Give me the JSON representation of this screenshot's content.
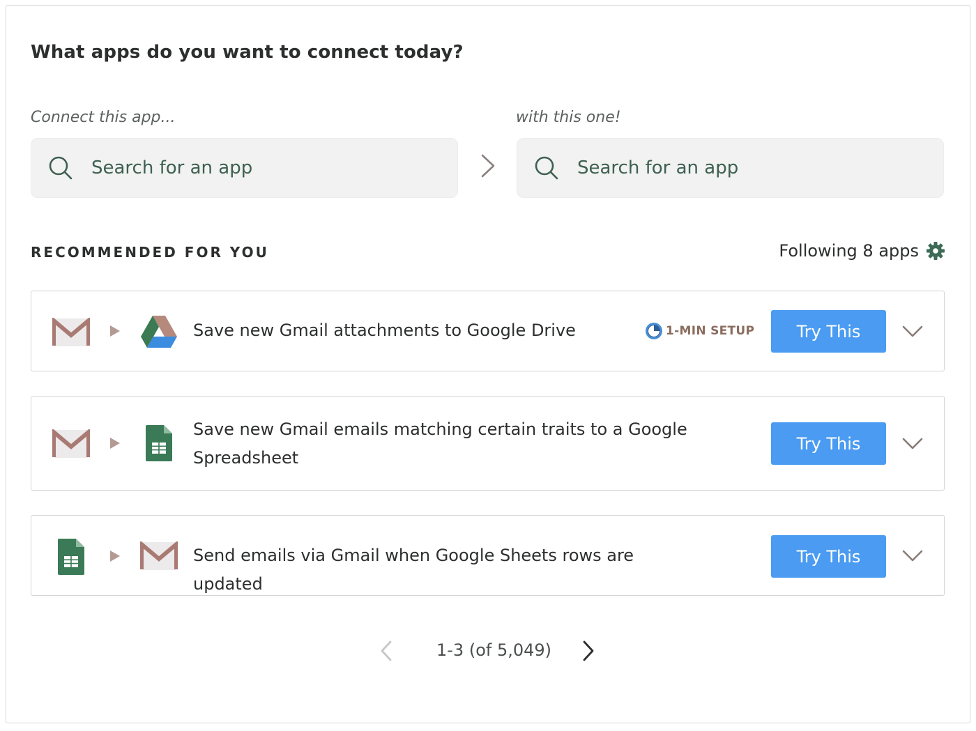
{
  "header": {
    "title": "What apps do you want to connect today?"
  },
  "connect": {
    "from_label": "Connect this app...",
    "to_label": "with this one!",
    "from_placeholder": "Search for an app",
    "to_placeholder": "Search for an app"
  },
  "recommended": {
    "heading": "RECOMMENDED FOR YOU",
    "following_label": "Following 8 apps",
    "items": [
      {
        "from_app": "gmail-icon",
        "to_app": "google-drive-icon",
        "description": "Save new Gmail attachments to Google Drive",
        "badge": "1-MIN SETUP",
        "button_label": "Try This"
      },
      {
        "from_app": "gmail-icon",
        "to_app": "google-sheets-icon",
        "description": "Save new Gmail emails matching certain traits to a Google Spreadsheet",
        "button_label": "Try This"
      },
      {
        "from_app": "google-sheets-icon",
        "to_app": "gmail-icon",
        "description": "Send emails via Gmail when Google Sheets rows are updated",
        "button_label": "Try This"
      }
    ]
  },
  "pagination": {
    "range_text": "1-3 (of 5,049)"
  },
  "colors": {
    "accent": "#4a9bf1",
    "search_text": "#3e6052",
    "gear": "#3d6b55",
    "badge": "#8a6c5e",
    "clock": "#4a8fd6"
  }
}
